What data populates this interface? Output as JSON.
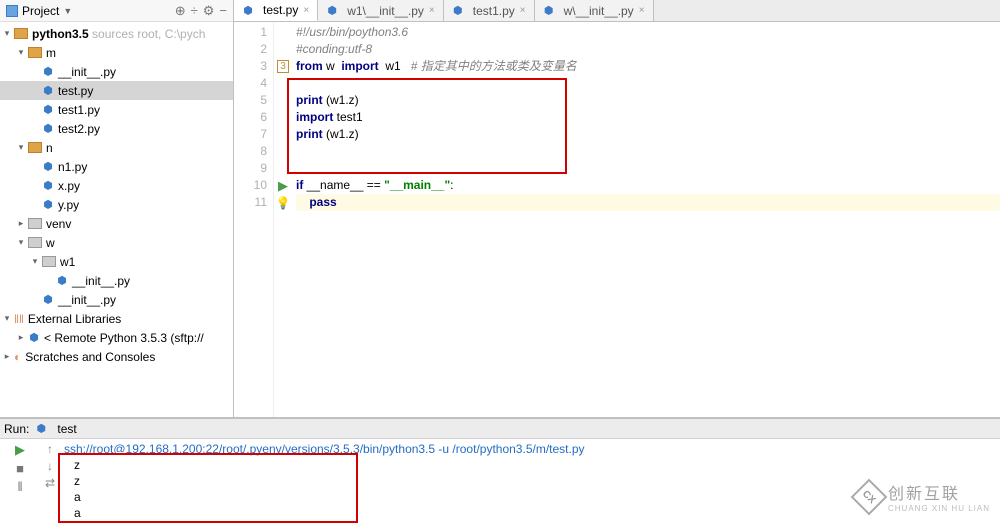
{
  "sidebar": {
    "title": "Project",
    "root": {
      "name": "python3.5",
      "hint": "sources root, C:\\pych"
    },
    "tree": {
      "m": "m",
      "m_children": [
        "__init__.py",
        "test.py",
        "test1.py",
        "test2.py"
      ],
      "n": "n",
      "n_children": [
        "n1.py",
        "x.py",
        "y.py"
      ],
      "venv": "venv",
      "w": "w",
      "w1": "w1",
      "w1_children": [
        "__init__.py"
      ],
      "w_children": [
        "__init__.py"
      ],
      "ext": "External Libraries",
      "remote": "< Remote Python 3.5.3 (sftp://",
      "scratches": "Scratches and Consoles"
    }
  },
  "tabs": [
    {
      "label": "test.py",
      "active": true
    },
    {
      "label": "w1\\__init__.py",
      "active": false
    },
    {
      "label": "test1.py",
      "active": false
    },
    {
      "label": "w\\__init__.py",
      "active": false
    }
  ],
  "code": {
    "l1": "#!/usr/bin/poython3.6",
    "l2": "#conding:utf-8",
    "l3a": "from",
    "l3b": " w  ",
    "l3c": "import",
    "l3d": "  w1   ",
    "l3e": "# 指定其中的方法或类及变量名",
    "l5a": "print",
    "l5b": " (w1.z)",
    "l6a": "import",
    "l6b": " test1",
    "l7a": "print",
    "l7b": " (w1.z)",
    "l10a": "if",
    "l10b": " __name__ == ",
    "l10c": "\"__main__\"",
    "l10d": ":",
    "l11a": "pass"
  },
  "run": {
    "label": "Run:",
    "title": "test",
    "cmd": "ssh://root@192.168.1.200:22/root/.pyenv/versions/3.5.3/bin/python3.5 -u /root/python3.5/m/test.py",
    "out": [
      "z",
      "z",
      "a",
      "a"
    ]
  },
  "watermark": {
    "text": "创新互联",
    "sub": "CHUANG XIN HU LIAN"
  }
}
